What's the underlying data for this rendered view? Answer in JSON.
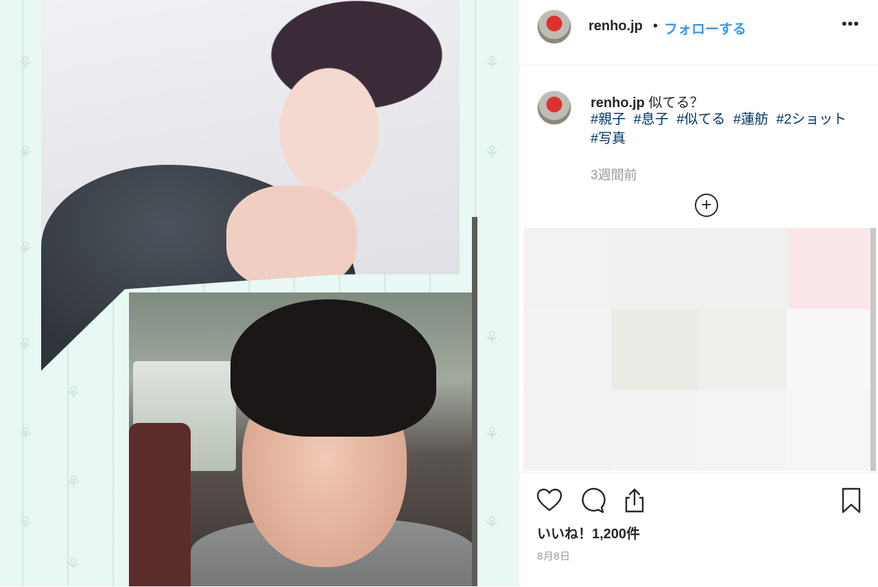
{
  "post": {
    "username": "renho.jp",
    "separator": "•",
    "follow_label": "フォローする",
    "more_label": "•••",
    "caption_user": "renho.jp",
    "caption_text": "似てる？",
    "hashtags": [
      "#親子",
      "#息子",
      "#似てる",
      "#蓮舫",
      "#2ショット",
      "#写真"
    ],
    "time_ago": "3週間前",
    "load_more_label": "+",
    "likes_text": "いいね！1,200件",
    "date_text": "8月8日"
  },
  "icons": {
    "more": "more-options-icon",
    "load_more": "plus-circle-icon",
    "like": "heart-icon",
    "comment": "comment-icon",
    "share": "share-icon",
    "save": "bookmark-icon"
  },
  "colors": {
    "follow": "#3897f0",
    "hashtag": "#003569",
    "muted": "#999999"
  },
  "mosaic_colors": [
    "#f2f2f2",
    "#f1f1f1",
    "#f0f0ef",
    "#fbe7ea",
    "#f3f3f3",
    "#ecebe8",
    "#efefec",
    "#f8f8f8",
    "#f2f2f2",
    "#f3f3f3",
    "#f4f4f4",
    "#f6f6f6"
  ]
}
